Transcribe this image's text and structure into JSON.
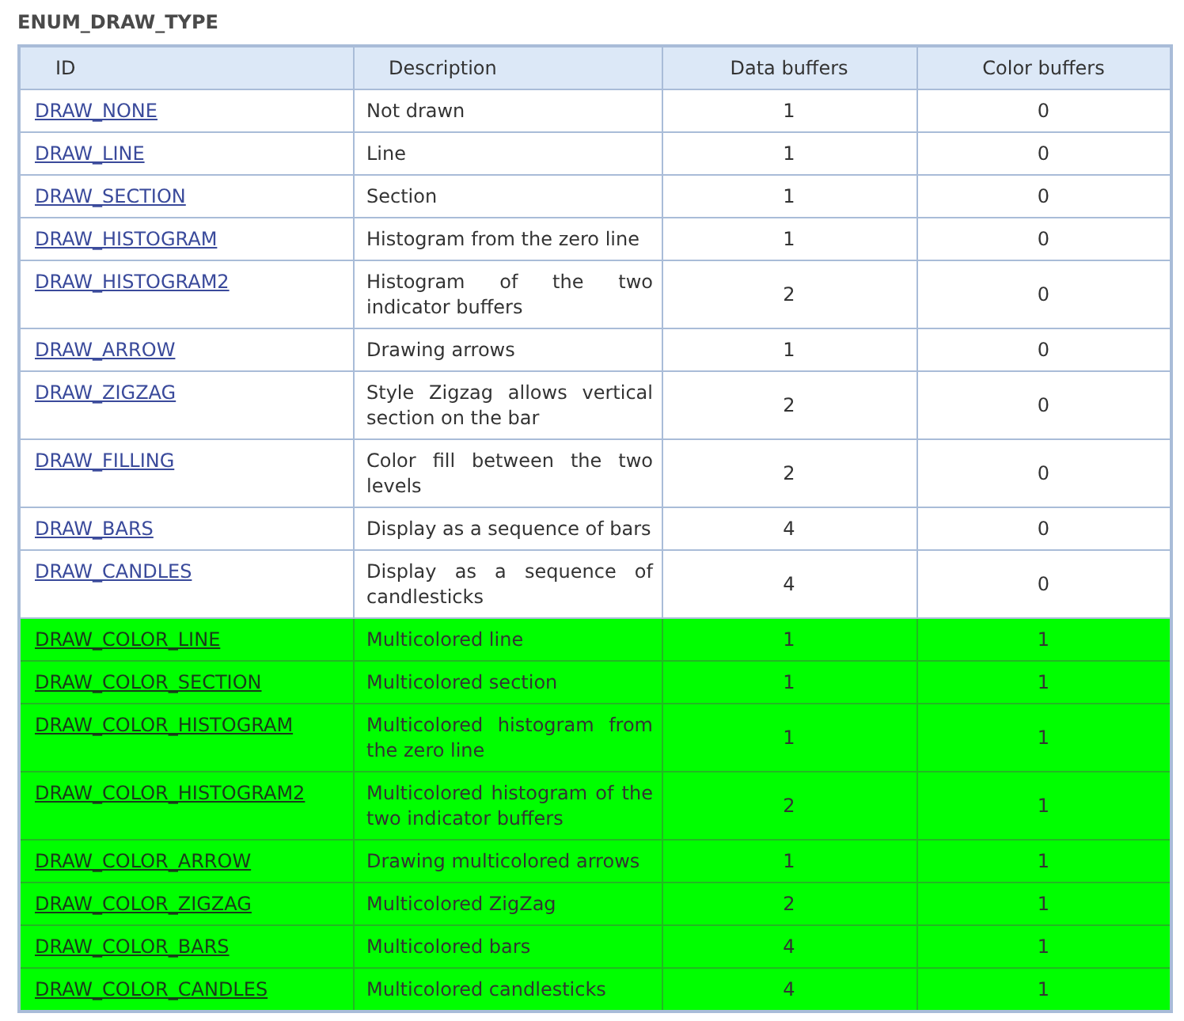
{
  "title": "ENUM_DRAW_TYPE",
  "table": {
    "columns": [
      "ID",
      "Description",
      "Data buffers",
      "Color buffers"
    ],
    "rows": [
      {
        "id": "DRAW_NONE",
        "description": "Not drawn",
        "data_buffers": "1",
        "color_buffers": "0",
        "highlighted": false
      },
      {
        "id": "DRAW_LINE",
        "description": "Line",
        "data_buffers": "1",
        "color_buffers": "0",
        "highlighted": false
      },
      {
        "id": "DRAW_SECTION",
        "description": "Section",
        "data_buffers": "1",
        "color_buffers": "0",
        "highlighted": false
      },
      {
        "id": "DRAW_HISTOGRAM",
        "description": "Histogram from the zero line",
        "data_buffers": "1",
        "color_buffers": "0",
        "highlighted": false
      },
      {
        "id": "DRAW_HISTOGRAM2",
        "description": "Histogram of the two indicator buffers",
        "data_buffers": "2",
        "color_buffers": "0",
        "highlighted": false
      },
      {
        "id": "DRAW_ARROW",
        "description": "Drawing arrows",
        "data_buffers": "1",
        "color_buffers": "0",
        "highlighted": false
      },
      {
        "id": "DRAW_ZIGZAG",
        "description": "Style Zigzag allows vertical section on the bar",
        "data_buffers": "2",
        "color_buffers": "0",
        "highlighted": false
      },
      {
        "id": "DRAW_FILLING",
        "description": "Color fill between the two levels",
        "data_buffers": "2",
        "color_buffers": "0",
        "highlighted": false
      },
      {
        "id": "DRAW_BARS",
        "description": "Display as a sequence of bars",
        "data_buffers": "4",
        "color_buffers": "0",
        "highlighted": false
      },
      {
        "id": "DRAW_CANDLES",
        "description": "Display as a sequence of candlesticks",
        "data_buffers": "4",
        "color_buffers": "0",
        "highlighted": false
      },
      {
        "id": "DRAW_COLOR_LINE",
        "description": "Multicolored line",
        "data_buffers": "1",
        "color_buffers": "1",
        "highlighted": true
      },
      {
        "id": "DRAW_COLOR_SECTION",
        "description": "Multicolored section",
        "data_buffers": "1",
        "color_buffers": "1",
        "highlighted": true
      },
      {
        "id": "DRAW_COLOR_HISTOGRAM",
        "description": "Multicolored histogram from the zero line",
        "data_buffers": "1",
        "color_buffers": "1",
        "highlighted": true
      },
      {
        "id": "DRAW_COLOR_HISTOGRAM2",
        "description": "Multicolored histogram of the two indicator buffers",
        "data_buffers": "2",
        "color_buffers": "1",
        "highlighted": true
      },
      {
        "id": "DRAW_COLOR_ARROW",
        "description": "Drawing multicolored arrows",
        "data_buffers": "1",
        "color_buffers": "1",
        "highlighted": true
      },
      {
        "id": "DRAW_COLOR_ZIGZAG",
        "description": "Multicolored ZigZag",
        "data_buffers": "2",
        "color_buffers": "1",
        "highlighted": true
      },
      {
        "id": "DRAW_COLOR_BARS",
        "description": "Multicolored bars",
        "data_buffers": "4",
        "color_buffers": "1",
        "highlighted": true
      },
      {
        "id": "DRAW_COLOR_CANDLES",
        "description": "Multicolored candlesticks",
        "data_buffers": "4",
        "color_buffers": "1",
        "highlighted": true
      }
    ]
  }
}
